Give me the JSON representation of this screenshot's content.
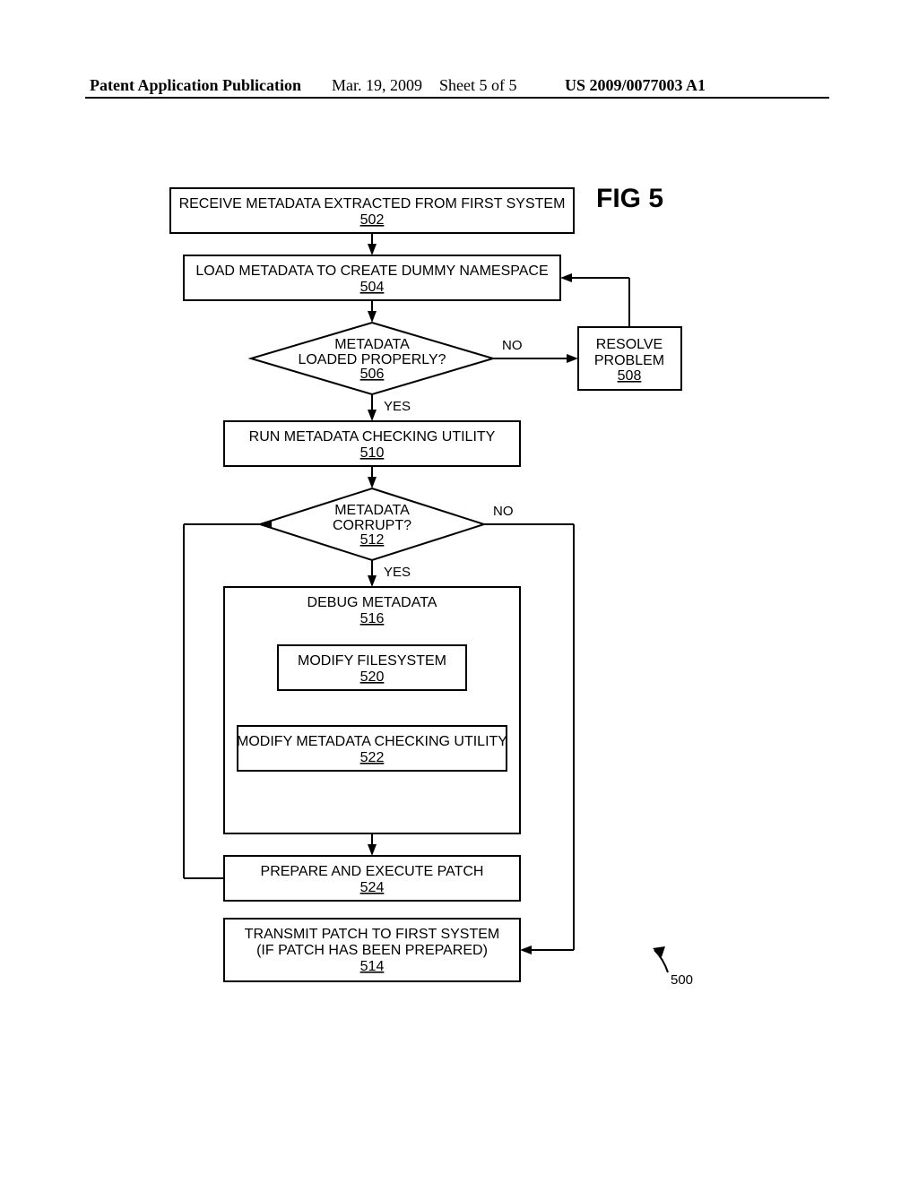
{
  "header": {
    "pub": "Patent Application Publication",
    "date": "Mar. 19, 2009",
    "sheet": "Sheet 5 of 5",
    "app": "US 2009/0077003 A1"
  },
  "figure": {
    "title": "FIG 5",
    "ref_overall": "500",
    "boxes": {
      "b502": {
        "text": "RECEIVE METADATA EXTRACTED FROM FIRST SYSTEM",
        "ref": "502"
      },
      "b504": {
        "text": "LOAD METADATA TO CREATE DUMMY NAMESPACE",
        "ref": "504"
      },
      "d506": {
        "line1": "METADATA",
        "line2": "LOADED PROPERLY?",
        "ref": "506"
      },
      "b508": {
        "line1": "RESOLVE",
        "line2": "PROBLEM",
        "ref": "508"
      },
      "b510": {
        "text": "RUN METADATA CHECKING UTILITY",
        "ref": "510"
      },
      "d512": {
        "line1": "METADATA",
        "line2": "CORRUPT?",
        "ref": "512"
      },
      "b516": {
        "text": "DEBUG METADATA",
        "ref": "516"
      },
      "b520": {
        "text": "MODIFY FILESYSTEM",
        "ref": "520"
      },
      "b522": {
        "text": "MODIFY METADATA CHECKING UTILITY",
        "ref": "522"
      },
      "b524": {
        "text": "PREPARE AND EXECUTE PATCH",
        "ref": "524"
      },
      "b514": {
        "line1": "TRANSMIT PATCH TO FIRST SYSTEM",
        "line2": "(IF PATCH HAS BEEN PREPARED)",
        "ref": "514"
      }
    },
    "labels": {
      "no506": "NO",
      "yes506": "YES",
      "no512": "NO",
      "yes512": "YES"
    }
  }
}
